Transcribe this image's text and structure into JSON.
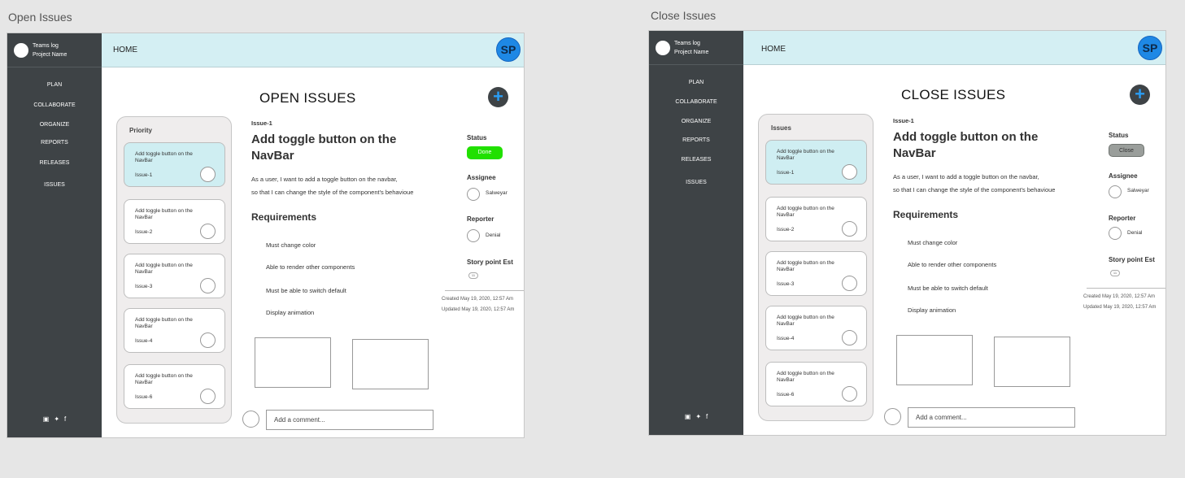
{
  "artboards": [
    {
      "label": "Open Issues",
      "brand": {
        "line1": "Teams log",
        "line2": "Project Name"
      },
      "nav": [
        "PLAN",
        "COLLABORATE",
        "ORGANIZE",
        "REPORTS",
        "RELEASES",
        "ISSUES"
      ],
      "social_icons": [
        "instagram-icon",
        "twitter-icon",
        "facebook-icon"
      ],
      "home_label": "HOME",
      "user_initials": "SP",
      "page_title": "OPEN ISSUES",
      "add_button": "+",
      "list_title": "Priority",
      "cards": [
        {
          "title": "Add toggle button on the NavBar",
          "id": "Issue-1",
          "active": true
        },
        {
          "title": "Add toggle button on the NavBar",
          "id": "Issue-2"
        },
        {
          "title": "Add toggle button on the NavBar",
          "id": "Issue-3"
        },
        {
          "title": "Add toggle button on the NavBar",
          "id": "Issue-4"
        },
        {
          "title": "Add toggle button on the NavBar",
          "id": "Issue-6"
        }
      ],
      "detail": {
        "id": "Issue-1",
        "title": "Add toggle button on the NavBar",
        "desc_line1": "As a user, I want to add a toggle button on the navbar,",
        "desc_line2": "so that I can change the style of the component's behavioue",
        "requirements_heading": "Requirements",
        "requirements": [
          "Must change color",
          "Able to render other components",
          "Must be able to switch default",
          "Display animation"
        ],
        "comment_placeholder": "Add a comment..."
      },
      "meta": {
        "status_label": "Status",
        "status_value": "Done",
        "status_color": "#21e000",
        "assignee_label": "Assignee",
        "assignee_name": "Salweyar",
        "reporter_label": "Reporter",
        "reporter_name": "Denial",
        "story_label": "Story point Est",
        "story_value": "11",
        "created": "Created May 19, 2020, 12:57 Am",
        "updated": "Updated May 19, 2020, 12:57 Am"
      }
    },
    {
      "label": "Close Issues",
      "brand": {
        "line1": "Teams log",
        "line2": "Project Name"
      },
      "nav": [
        "PLAN",
        "COLLABORATE",
        "ORGANIZE",
        "REPORTS",
        "RELEASES",
        "ISSUES"
      ],
      "social_icons": [
        "instagram-icon",
        "twitter-icon",
        "facebook-icon"
      ],
      "home_label": "HOME",
      "user_initials": "SP",
      "page_title": "CLOSE ISSUES",
      "add_button": "+",
      "list_title": "Issues",
      "cards": [
        {
          "title": "Add toggle button on the NavBar",
          "id": "Issue-1",
          "active": true
        },
        {
          "title": "Add toggle button on the NavBar",
          "id": "Issue-2"
        },
        {
          "title": "Add toggle button on the NavBar",
          "id": "Issue-3"
        },
        {
          "title": "Add toggle button on the NavBar",
          "id": "Issue-4"
        },
        {
          "title": "Add toggle button on the NavBar",
          "id": "Issue-6"
        }
      ],
      "detail": {
        "id": "Issue-1",
        "title": "Add toggle button on the NavBar",
        "desc_line1": "As a user, I want to add a toggle button on the navbar,",
        "desc_line2": "so that I can change the style of the component's behavioue",
        "requirements_heading": "Requirements",
        "requirements": [
          "Must change color",
          "Able to render other components",
          "Must be able to switch default",
          "Display animation"
        ],
        "comment_placeholder": "Add a comment..."
      },
      "meta": {
        "status_label": "Status",
        "status_value": "Close",
        "status_color": "#9a9e9b",
        "assignee_label": "Assignee",
        "assignee_name": "Salweyar",
        "reporter_label": "Reporter",
        "reporter_name": "Denial",
        "story_label": "Story point Est",
        "story_value": "11",
        "created": "Created May 19, 2020, 12:57 Am",
        "updated": "Updated May 19, 2020, 12:57 Am"
      }
    }
  ]
}
